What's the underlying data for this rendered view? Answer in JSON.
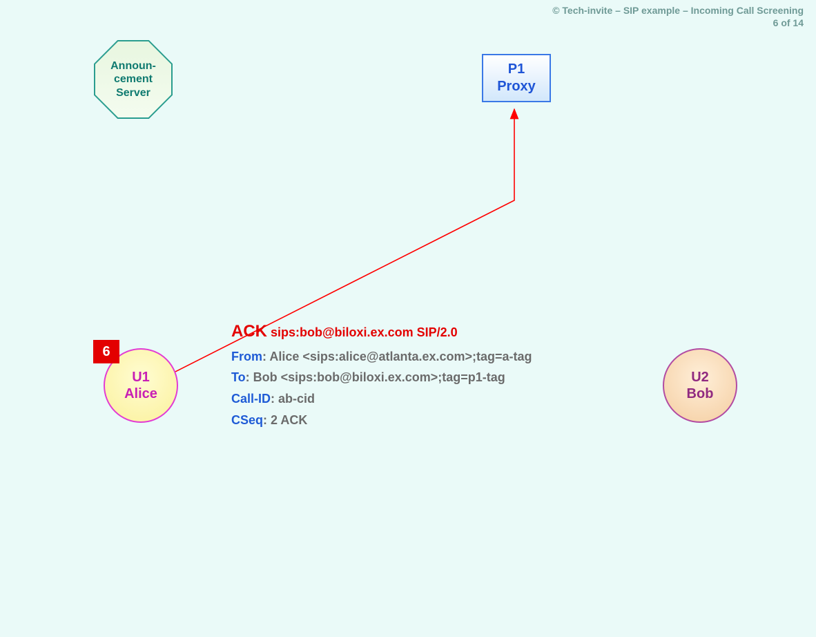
{
  "header": {
    "line1": "© Tech-invite – SIP example – Incoming Call Screening",
    "line2": "6 of 14"
  },
  "nodes": {
    "announcement": {
      "line1": "Announ-",
      "line2": "cement",
      "line3": "Server"
    },
    "proxy": {
      "line1": "P1",
      "line2": "Proxy"
    },
    "alice": {
      "line1": "U1",
      "line2": "Alice"
    },
    "bob": {
      "line1": "U2",
      "line2": "Bob"
    }
  },
  "step": {
    "number": "6"
  },
  "message": {
    "method": "ACK",
    "request_rest": " sips:bob@biloxi.ex.com SIP/2.0",
    "headers": [
      {
        "name": "From",
        "value": ": Alice <sips:alice@atlanta.ex.com>;tag=a-tag"
      },
      {
        "name": "To",
        "value": ": Bob <sips:bob@biloxi.ex.com>;tag=p1-tag"
      },
      {
        "name": "Call-ID",
        "value": ": ab-cid"
      },
      {
        "name": "CSeq",
        "value": ": 2 ACK"
      }
    ]
  },
  "colors": {
    "bg": "#eafaf8",
    "red": "#e30000",
    "blue": "#1f5bd6",
    "grey": "#6b6b6b",
    "teal": "#0f7a70"
  }
}
